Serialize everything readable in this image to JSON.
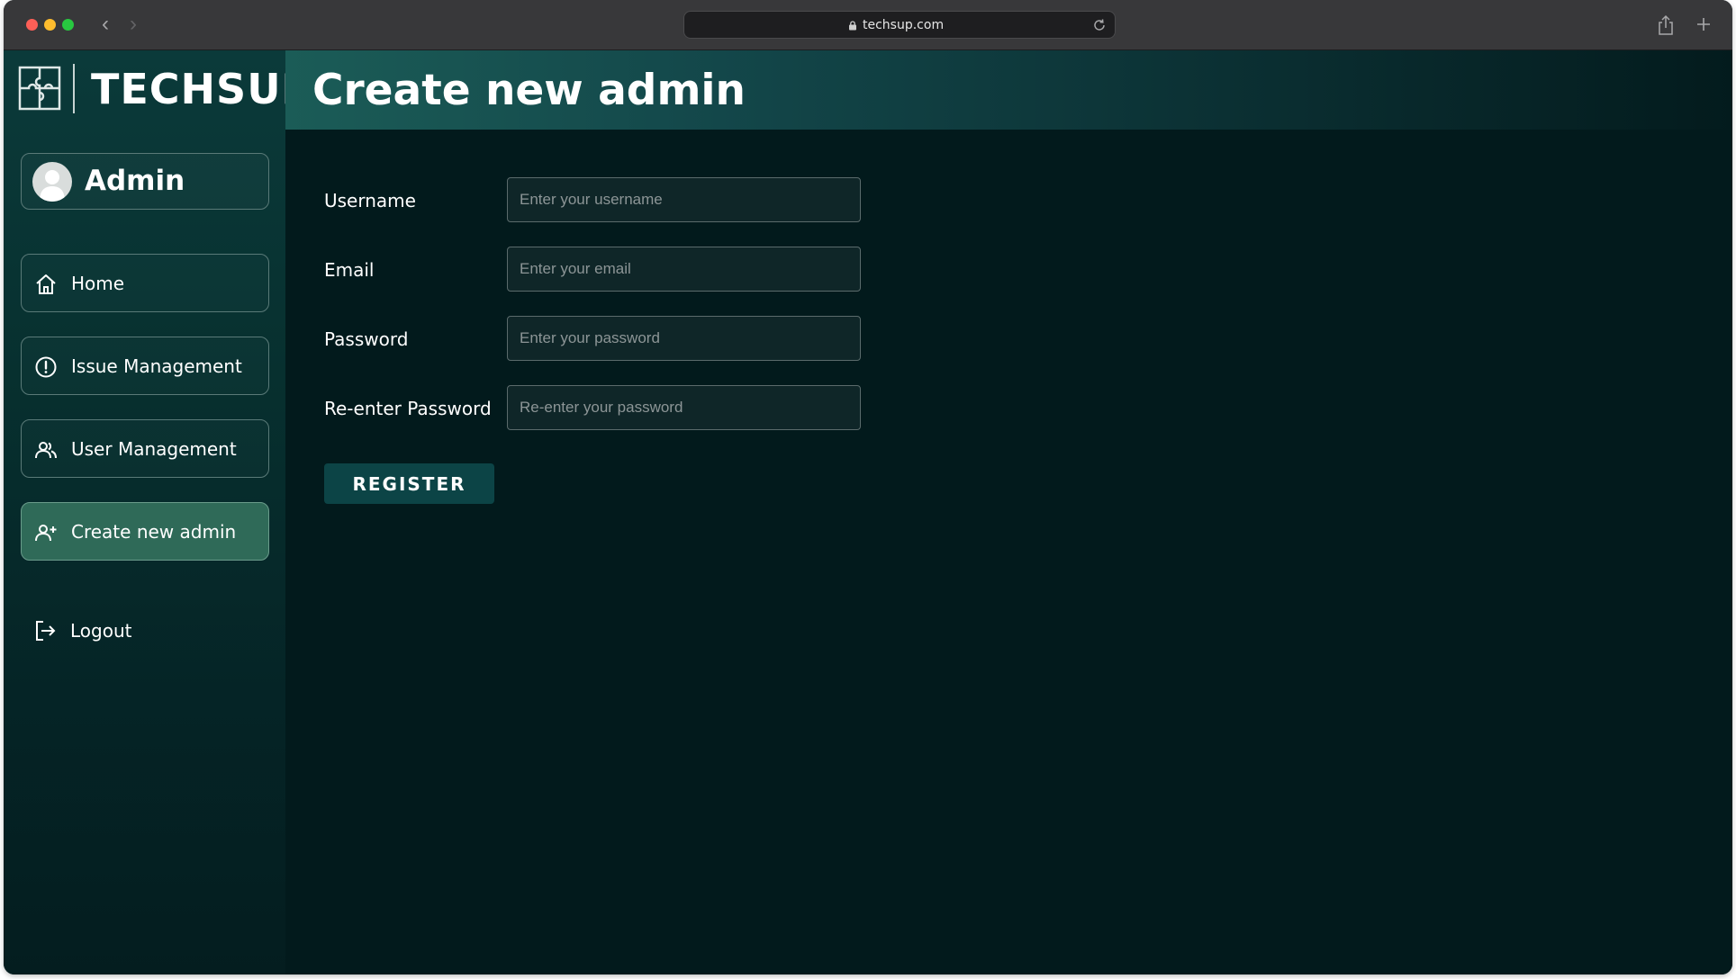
{
  "browser": {
    "url": "techsup.com"
  },
  "sidebar": {
    "brand": "TECHSUP",
    "user": "Admin",
    "items": [
      {
        "label": "Home",
        "icon": "home-icon"
      },
      {
        "label": "Issue Management",
        "icon": "alert-circle-icon"
      },
      {
        "label": "User Management",
        "icon": "users-icon"
      },
      {
        "label": "Create new admin",
        "icon": "user-plus-icon",
        "active": true
      }
    ],
    "logout": "Logout"
  },
  "main": {
    "title": "Create new admin",
    "form": {
      "fields": [
        {
          "label": "Username",
          "placeholder": "Enter your username",
          "value": ""
        },
        {
          "label": "Email",
          "placeholder": "Enter your email",
          "value": ""
        },
        {
          "label": "Password",
          "placeholder": "Enter your password",
          "value": ""
        },
        {
          "label": "Re-enter Password",
          "placeholder": "Re-enter your password",
          "value": ""
        }
      ],
      "submit": "REGISTER"
    }
  },
  "colors": {
    "sidebar_bg": "#07302f",
    "content_bg": "#021a1c",
    "active_item": "#2f6a58",
    "button_bg": "#0c4446"
  }
}
